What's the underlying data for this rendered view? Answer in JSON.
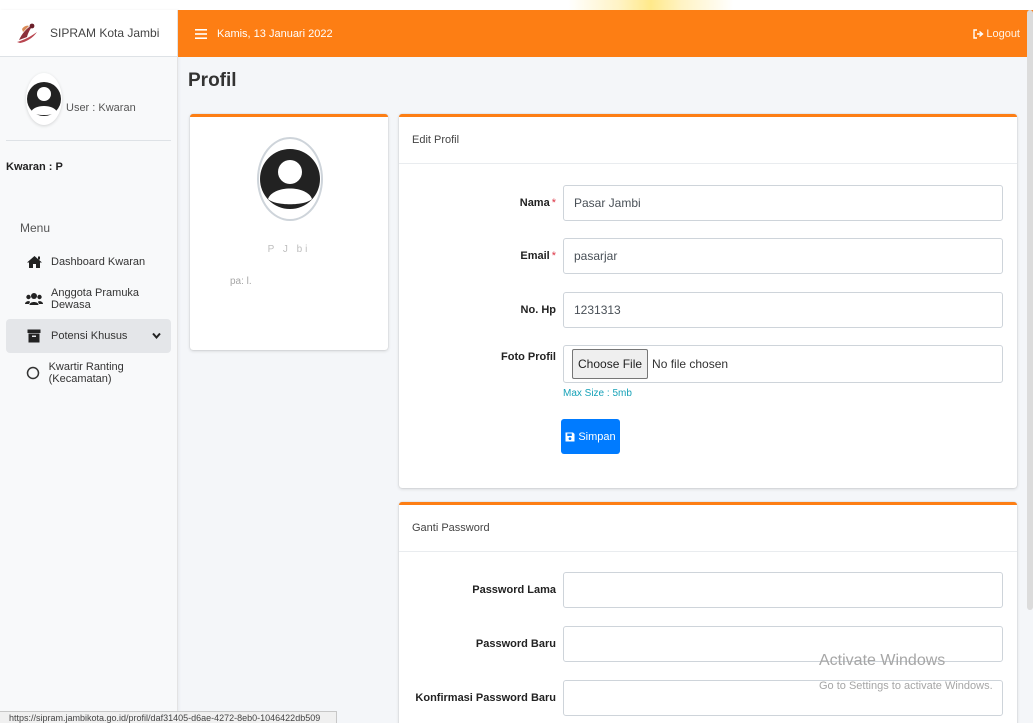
{
  "app": {
    "title": "SIPRAM Kota Jambi"
  },
  "navbar": {
    "date": "Kamis, 13 Januari 2022",
    "logout_label": "Logout"
  },
  "sidebar": {
    "user_label": "User : Kwaran",
    "kwaran_label": "Kwaran : P",
    "menu_heading": "Menu",
    "items": [
      {
        "label": "Dashboard Kwaran",
        "icon": "home-icon"
      },
      {
        "label": "Anggota Pramuka Dewasa",
        "icon": "users-icon"
      },
      {
        "label": "Potensi Khusus",
        "icon": "archive-icon",
        "active": true
      },
      {
        "label": "Kwartir Ranting (Kecamatan)",
        "icon": "circle-icon"
      }
    ]
  },
  "page": {
    "title": "Profil"
  },
  "profile_card": {
    "name": "P     J    bi",
    "email": "pa:        l.    "
  },
  "edit_profile": {
    "header": "Edit Profil",
    "fields": {
      "nama": {
        "label": "Nama",
        "value": "Pasar Jambi"
      },
      "email": {
        "label": "Email",
        "value": "pasarjar"
      },
      "hp": {
        "label": "No. Hp",
        "value": "1231313"
      },
      "foto": {
        "label": "Foto Profil",
        "button": "Choose File",
        "status": "No file chosen",
        "hint": "Max Size : 5mb"
      }
    },
    "save_label": "Simpan"
  },
  "change_password": {
    "header": "Ganti Password",
    "fields": {
      "old": {
        "label": "Password Lama",
        "value": ""
      },
      "new": {
        "label": "Password Baru",
        "value": ""
      },
      "confirm": {
        "label": "Konfirmasi Password Baru",
        "value": ""
      }
    }
  },
  "status_url": "https://sipram.jambikota.go.id/profil/daf31405-d6ae-4272-8eb0-1046422db509",
  "watermark": {
    "title": "Activate Windows",
    "subtitle": "Go to Settings to activate Windows."
  },
  "colors": {
    "accent": "#fd7e14",
    "primary": "#007bff",
    "required": "#dc3545",
    "info": "#17a2b8"
  }
}
